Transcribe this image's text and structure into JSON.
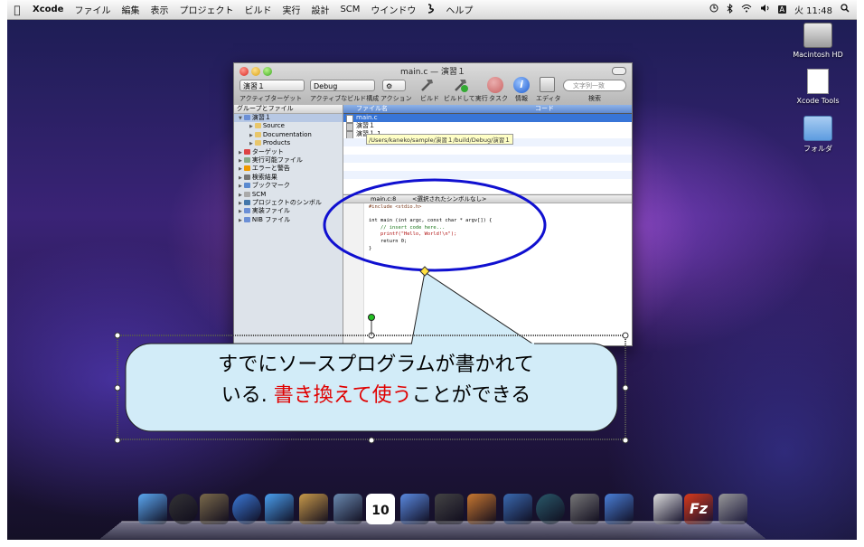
{
  "menubar": {
    "apple": "",
    "items": [
      "Xcode",
      "ファイル",
      "編集",
      "表示",
      "プロジェクト",
      "ビルド",
      "実行",
      "設計",
      "SCM",
      "ウインドウ",
      "",
      "ヘルプ"
    ],
    "clock": "火 11:48",
    "input_badge": "A"
  },
  "desktop_icons": [
    {
      "label": "Macintosh HD",
      "icon": "hard-disk-icon"
    },
    {
      "label": "Xcode Tools",
      "icon": "document-icon"
    },
    {
      "label": "フォルダ",
      "icon": "folder-icon"
    }
  ],
  "window": {
    "title": "main.c — 演習１",
    "target_popup": "演習１",
    "config_popup": "Debug",
    "action_popup": "",
    "toolbar_labels": [
      "アクティブターゲット",
      "アクティブなビルド構成",
      "アクション",
      "ビルド",
      "ビルドして実行",
      "タスク",
      "情報",
      "エディタ",
      "検索"
    ],
    "search_placeholder": "文字列一致",
    "groups_header": "グループとファイル",
    "groups": [
      {
        "label": "演習１",
        "color": "#6b8fd6"
      },
      {
        "label": "Source",
        "color": "#e8c66a"
      },
      {
        "label": "Documentation",
        "color": "#e8c66a"
      },
      {
        "label": "Products",
        "color": "#e8c66a"
      },
      {
        "label": "ターゲット",
        "color": "#d44"
      },
      {
        "label": "実行可能ファイル",
        "color": "#8a8"
      },
      {
        "label": "エラーと警告",
        "color": "#e90"
      },
      {
        "label": "検索結果",
        "color": "#777"
      },
      {
        "label": "ブックマーク",
        "color": "#5a8ad0"
      },
      {
        "label": "SCM",
        "color": "#aaa"
      },
      {
        "label": "プロジェクトのシンボル",
        "color": "#47a"
      },
      {
        "label": "実装ファイル",
        "color": "#6b8fd6"
      },
      {
        "label": "NIB ファイル",
        "color": "#6b8fd6"
      }
    ],
    "files_header": {
      "name": "ファイル名",
      "code": "コード"
    },
    "files": [
      {
        "name": "main.c",
        "selected": true
      },
      {
        "name": "演習１",
        "selected": false
      },
      {
        "name": "演習１.1",
        "selected": false
      }
    ],
    "tooltip": "/Users/kaneko/sample/演習１/build/Debug/演習１",
    "editor_nav": {
      "file": "main.c:8",
      "symbol": "<選択されたシンボルなし>"
    },
    "code_lines": [
      "#include <stdio.h>",
      "",
      "int main (int argc, const char * argv[]) {",
      "    // insert code here...",
      "    printf(\"Hello, World!\\n\");",
      "    return 0;",
      "}"
    ]
  },
  "callout": {
    "line1": "すでにソースプログラムが書かれて",
    "line2_prefix": "いる. ",
    "line2_red": "書き換えて使う",
    "line2_suffix": "ことができる",
    "highlight_color": "#e00000",
    "fill_color": "#d2ecf8",
    "ellipse_color": "#1010d0"
  },
  "dock": {
    "icons": [
      "finder-icon",
      "dashboard-icon",
      "preview-icon",
      "safari-icon",
      "ichat-icon",
      "address-book-icon",
      "iphoto-icon",
      "ical-icon",
      "itunes-icon",
      "imovie-icon",
      "garageband-icon",
      "spaces-icon",
      "time-machine-icon",
      "system-preferences-icon",
      "xcode-icon",
      "document-stack-icon",
      "filezilla-icon",
      "trash-icon"
    ],
    "ical_date": "10",
    "filezilla_letter": "Fz"
  }
}
